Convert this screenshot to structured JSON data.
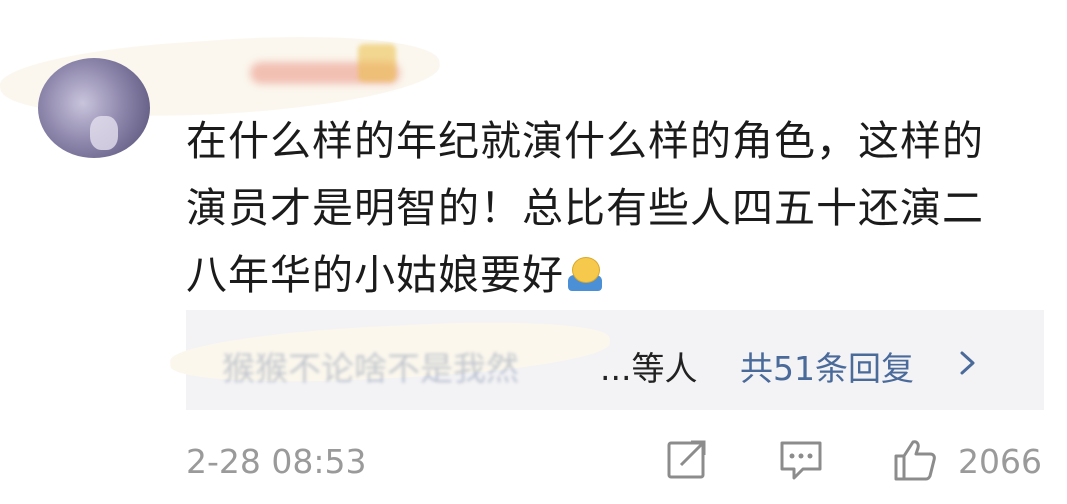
{
  "comment": {
    "username_obscured": "··· ····",
    "lines": [
      "在什么样的年纪就演什么样的角色，这样的",
      "演员才是明智的！总比有些人四五十还演二",
      "八年华的小姑娘要好"
    ],
    "emoji": "shrug-emoji"
  },
  "replies": {
    "obscured_names": "猴猴不论啥不是我然",
    "tail_text": "...等人",
    "count_label": "共51条回复"
  },
  "footer": {
    "timestamp": "2-28 08:53",
    "like_count": "2066"
  },
  "colors": {
    "text": "#1b1b1b",
    "link": "#4a6a9a",
    "muted": "#9a9a9a",
    "reply_bg": "#f3f3f5"
  },
  "icons": {
    "share": "share-icon",
    "comment": "comment-icon",
    "like": "thumbs-up-icon",
    "chevron": "chevron-right-icon"
  }
}
